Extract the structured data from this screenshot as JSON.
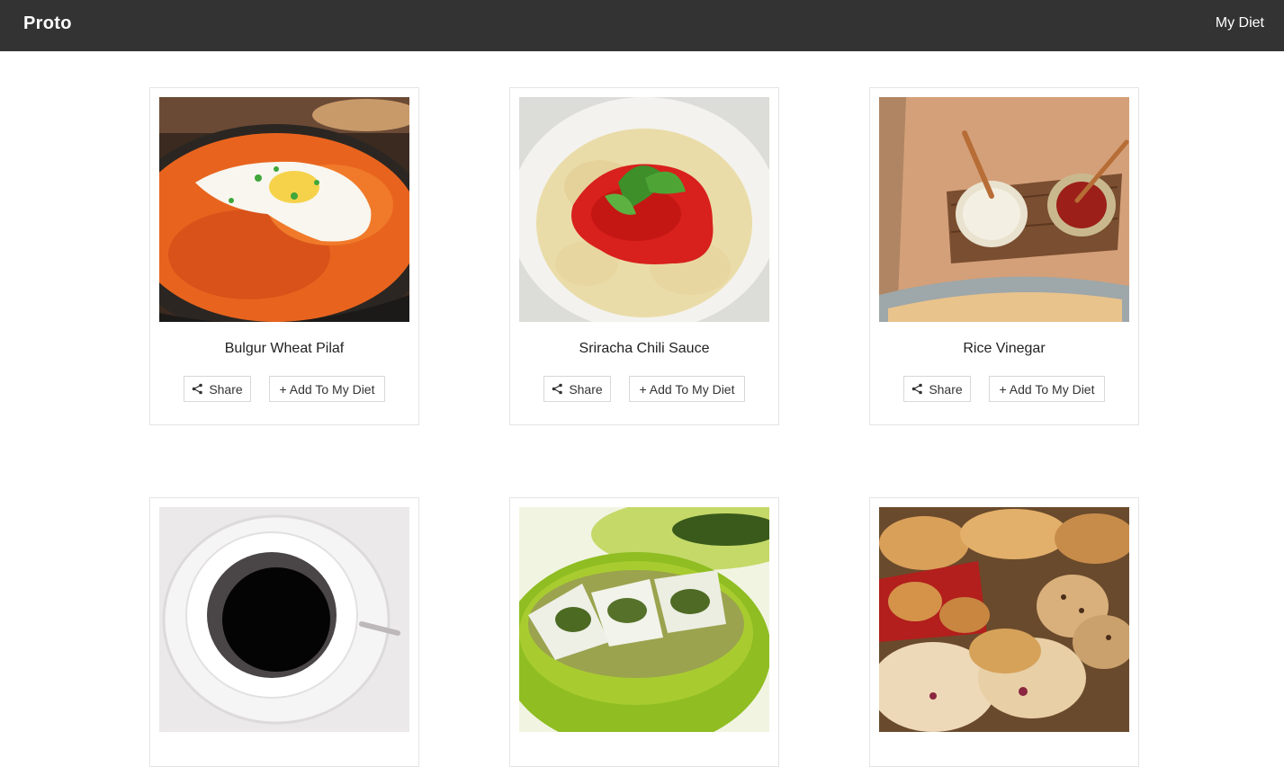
{
  "navbar": {
    "brand": "Proto",
    "link": "My Diet"
  },
  "cards": [
    {
      "title": "Bulgur Wheat Pilaf",
      "share_label": "Share",
      "add_label": "+ Add To My Diet"
    },
    {
      "title": "Sriracha Chili Sauce",
      "share_label": "Share",
      "add_label": "+ Add To My Diet"
    },
    {
      "title": "Rice Vinegar",
      "share_label": "Share",
      "add_label": "+ Add To My Diet"
    },
    {
      "title": "",
      "share_label": "",
      "add_label": ""
    },
    {
      "title": "",
      "share_label": "",
      "add_label": ""
    },
    {
      "title": "",
      "share_label": "",
      "add_label": ""
    }
  ],
  "icons": {
    "share": "share-icon"
  },
  "colors": {
    "navbar": "#333333",
    "card_border": "#e4e4e4"
  }
}
